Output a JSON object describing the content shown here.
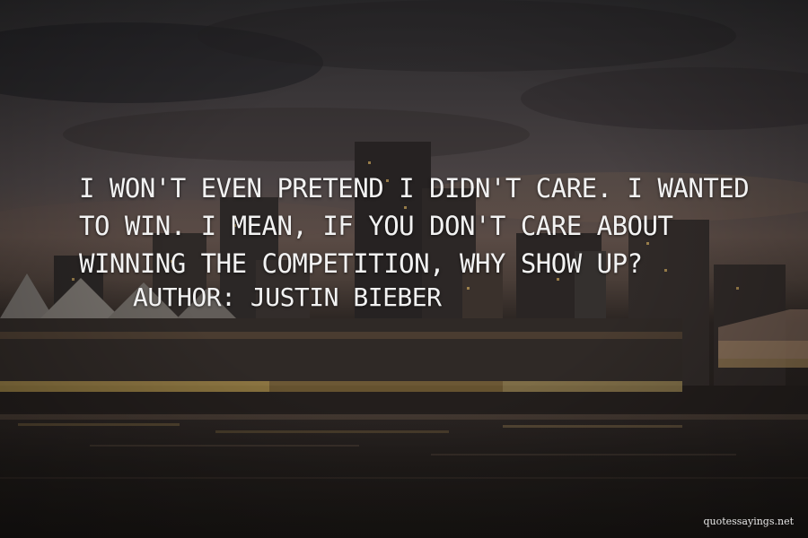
{
  "quote": {
    "text": "I won't even pretend I didn't care. I wanted to win. I mean, if you don't care about winning the competition, why show up?",
    "author_prefix": "Author: ",
    "author": "Justin Bieber"
  },
  "watermark": "quotessayings.net",
  "background": {
    "scene": "city skyline at dusk over water",
    "colors": {
      "sky": "#4a4344",
      "glow": "#e8c56a",
      "water": "#1f1b19"
    }
  }
}
